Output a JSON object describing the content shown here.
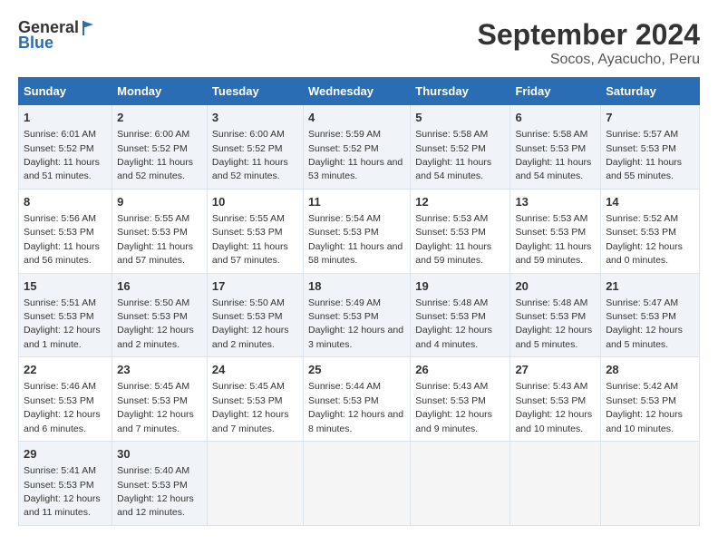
{
  "header": {
    "logo_line1": "General",
    "logo_line2": "Blue",
    "title": "September 2024",
    "subtitle": "Socos, Ayacucho, Peru"
  },
  "days_of_week": [
    "Sunday",
    "Monday",
    "Tuesday",
    "Wednesday",
    "Thursday",
    "Friday",
    "Saturday"
  ],
  "weeks": [
    [
      {
        "day": 1,
        "sunrise": "6:01 AM",
        "sunset": "5:52 PM",
        "daylight": "11 hours and 51 minutes."
      },
      {
        "day": 2,
        "sunrise": "6:00 AM",
        "sunset": "5:52 PM",
        "daylight": "11 hours and 52 minutes."
      },
      {
        "day": 3,
        "sunrise": "6:00 AM",
        "sunset": "5:52 PM",
        "daylight": "11 hours and 52 minutes."
      },
      {
        "day": 4,
        "sunrise": "5:59 AM",
        "sunset": "5:52 PM",
        "daylight": "11 hours and 53 minutes."
      },
      {
        "day": 5,
        "sunrise": "5:58 AM",
        "sunset": "5:52 PM",
        "daylight": "11 hours and 54 minutes."
      },
      {
        "day": 6,
        "sunrise": "5:58 AM",
        "sunset": "5:53 PM",
        "daylight": "11 hours and 54 minutes."
      },
      {
        "day": 7,
        "sunrise": "5:57 AM",
        "sunset": "5:53 PM",
        "daylight": "11 hours and 55 minutes."
      }
    ],
    [
      {
        "day": 8,
        "sunrise": "5:56 AM",
        "sunset": "5:53 PM",
        "daylight": "11 hours and 56 minutes."
      },
      {
        "day": 9,
        "sunrise": "5:55 AM",
        "sunset": "5:53 PM",
        "daylight": "11 hours and 57 minutes."
      },
      {
        "day": 10,
        "sunrise": "5:55 AM",
        "sunset": "5:53 PM",
        "daylight": "11 hours and 57 minutes."
      },
      {
        "day": 11,
        "sunrise": "5:54 AM",
        "sunset": "5:53 PM",
        "daylight": "11 hours and 58 minutes."
      },
      {
        "day": 12,
        "sunrise": "5:53 AM",
        "sunset": "5:53 PM",
        "daylight": "11 hours and 59 minutes."
      },
      {
        "day": 13,
        "sunrise": "5:53 AM",
        "sunset": "5:53 PM",
        "daylight": "11 hours and 59 minutes."
      },
      {
        "day": 14,
        "sunrise": "5:52 AM",
        "sunset": "5:53 PM",
        "daylight": "12 hours and 0 minutes."
      }
    ],
    [
      {
        "day": 15,
        "sunrise": "5:51 AM",
        "sunset": "5:53 PM",
        "daylight": "12 hours and 1 minute."
      },
      {
        "day": 16,
        "sunrise": "5:50 AM",
        "sunset": "5:53 PM",
        "daylight": "12 hours and 2 minutes."
      },
      {
        "day": 17,
        "sunrise": "5:50 AM",
        "sunset": "5:53 PM",
        "daylight": "12 hours and 2 minutes."
      },
      {
        "day": 18,
        "sunrise": "5:49 AM",
        "sunset": "5:53 PM",
        "daylight": "12 hours and 3 minutes."
      },
      {
        "day": 19,
        "sunrise": "5:48 AM",
        "sunset": "5:53 PM",
        "daylight": "12 hours and 4 minutes."
      },
      {
        "day": 20,
        "sunrise": "5:48 AM",
        "sunset": "5:53 PM",
        "daylight": "12 hours and 5 minutes."
      },
      {
        "day": 21,
        "sunrise": "5:47 AM",
        "sunset": "5:53 PM",
        "daylight": "12 hours and 5 minutes."
      }
    ],
    [
      {
        "day": 22,
        "sunrise": "5:46 AM",
        "sunset": "5:53 PM",
        "daylight": "12 hours and 6 minutes."
      },
      {
        "day": 23,
        "sunrise": "5:45 AM",
        "sunset": "5:53 PM",
        "daylight": "12 hours and 7 minutes."
      },
      {
        "day": 24,
        "sunrise": "5:45 AM",
        "sunset": "5:53 PM",
        "daylight": "12 hours and 7 minutes."
      },
      {
        "day": 25,
        "sunrise": "5:44 AM",
        "sunset": "5:53 PM",
        "daylight": "12 hours and 8 minutes."
      },
      {
        "day": 26,
        "sunrise": "5:43 AM",
        "sunset": "5:53 PM",
        "daylight": "12 hours and 9 minutes."
      },
      {
        "day": 27,
        "sunrise": "5:43 AM",
        "sunset": "5:53 PM",
        "daylight": "12 hours and 10 minutes."
      },
      {
        "day": 28,
        "sunrise": "5:42 AM",
        "sunset": "5:53 PM",
        "daylight": "12 hours and 10 minutes."
      }
    ],
    [
      {
        "day": 29,
        "sunrise": "5:41 AM",
        "sunset": "5:53 PM",
        "daylight": "12 hours and 11 minutes."
      },
      {
        "day": 30,
        "sunrise": "5:40 AM",
        "sunset": "5:53 PM",
        "daylight": "12 hours and 12 minutes."
      },
      null,
      null,
      null,
      null,
      null
    ]
  ]
}
